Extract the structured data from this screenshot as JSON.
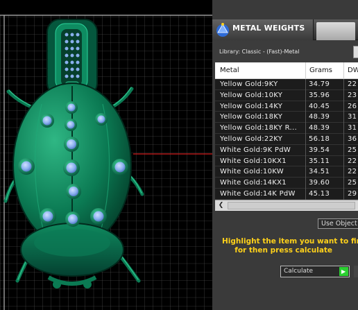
{
  "panel": {
    "title": "METAL WEIGHTS",
    "library_label": "Library: Classic - (Fast)-Metal",
    "columns": [
      "Metal",
      "Grams",
      "DW"
    ],
    "rows": [
      {
        "metal": "Yellow Gold:9KY",
        "grams": "34.79",
        "dwt": "22"
      },
      {
        "metal": "Yellow Gold:10KY",
        "grams": "35.96",
        "dwt": "23"
      },
      {
        "metal": "Yellow Gold:14KY",
        "grams": "40.45",
        "dwt": "26"
      },
      {
        "metal": "Yellow Gold:18KY",
        "grams": "48.39",
        "dwt": "31"
      },
      {
        "metal": "Yellow Gold:18KY R...",
        "grams": "48.39",
        "dwt": "31"
      },
      {
        "metal": "Yellow Gold:22KY",
        "grams": "56.18",
        "dwt": "36"
      },
      {
        "metal": "White Gold:9K PdW",
        "grams": "39.54",
        "dwt": "25"
      },
      {
        "metal": "White Gold:10KX1",
        "grams": "35.11",
        "dwt": "22"
      },
      {
        "metal": "White Gold:10KW",
        "grams": "34.51",
        "dwt": "22"
      },
      {
        "metal": "White Gold:14KX1",
        "grams": "39.60",
        "dwt": "25"
      },
      {
        "metal": "White Gold:14K PdW",
        "grams": "45.13",
        "dwt": "29"
      }
    ],
    "use_object_label": "Use Object",
    "instructions": "Highlight the item you want to find\n     for then press calculate",
    "calculate_label": "Calculate"
  },
  "colors": {
    "model_green": "#0c7a55",
    "gem_blue": "#8ab0ee",
    "instructions_yellow": "#ffd11a",
    "calc_green": "#2bd031"
  },
  "icons": {
    "app": "metal-weights-app-icon",
    "scroll_left": "scroll-left-icon",
    "calculate_go": "play-arrow-icon"
  }
}
